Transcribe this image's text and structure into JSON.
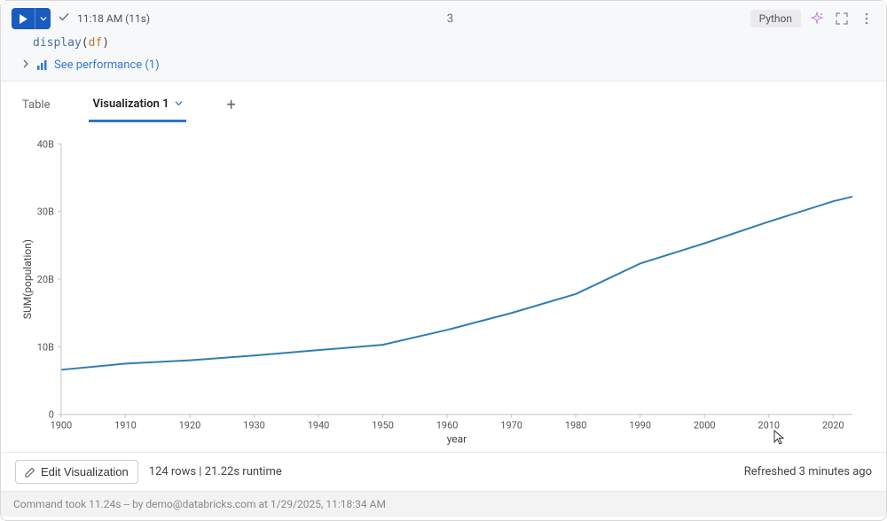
{
  "header": {
    "timestamp": "11:18 AM (11s)",
    "cell_number": "3",
    "language": "Python"
  },
  "code": {
    "fn": "display",
    "arg": "df"
  },
  "performance": {
    "link_text": "See performance (1)"
  },
  "tabs": {
    "table": "Table",
    "viz": "Visualization 1"
  },
  "footer": {
    "edit_btn": "Edit Visualization",
    "rows_runtime": "124 rows  |  21.22s runtime",
    "refreshed": "Refreshed 3 minutes ago"
  },
  "status": "Command took 11.24s -- by demo@databricks.com at 1/29/2025, 11:18:34 AM",
  "chart_data": {
    "type": "line",
    "xlabel": "year",
    "ylabel": "SUM(population)",
    "x": [
      1900,
      1910,
      1920,
      1930,
      1940,
      1950,
      1960,
      1970,
      1980,
      1990,
      2000,
      2010,
      2020,
      2023
    ],
    "y_billions": [
      6.6,
      7.5,
      8.0,
      8.7,
      9.5,
      10.3,
      12.5,
      15.0,
      17.8,
      22.3,
      25.3,
      28.5,
      31.5,
      32.2
    ],
    "xlim": [
      1900,
      2023
    ],
    "ylim": [
      0,
      40
    ],
    "x_ticks": [
      1900,
      1910,
      1920,
      1930,
      1940,
      1950,
      1960,
      1970,
      1980,
      1990,
      2000,
      2010,
      2020
    ],
    "y_ticks": [
      0,
      "10B",
      "20B",
      "30B",
      "40B"
    ],
    "y_tick_values": [
      0,
      10,
      20,
      30,
      40
    ]
  }
}
